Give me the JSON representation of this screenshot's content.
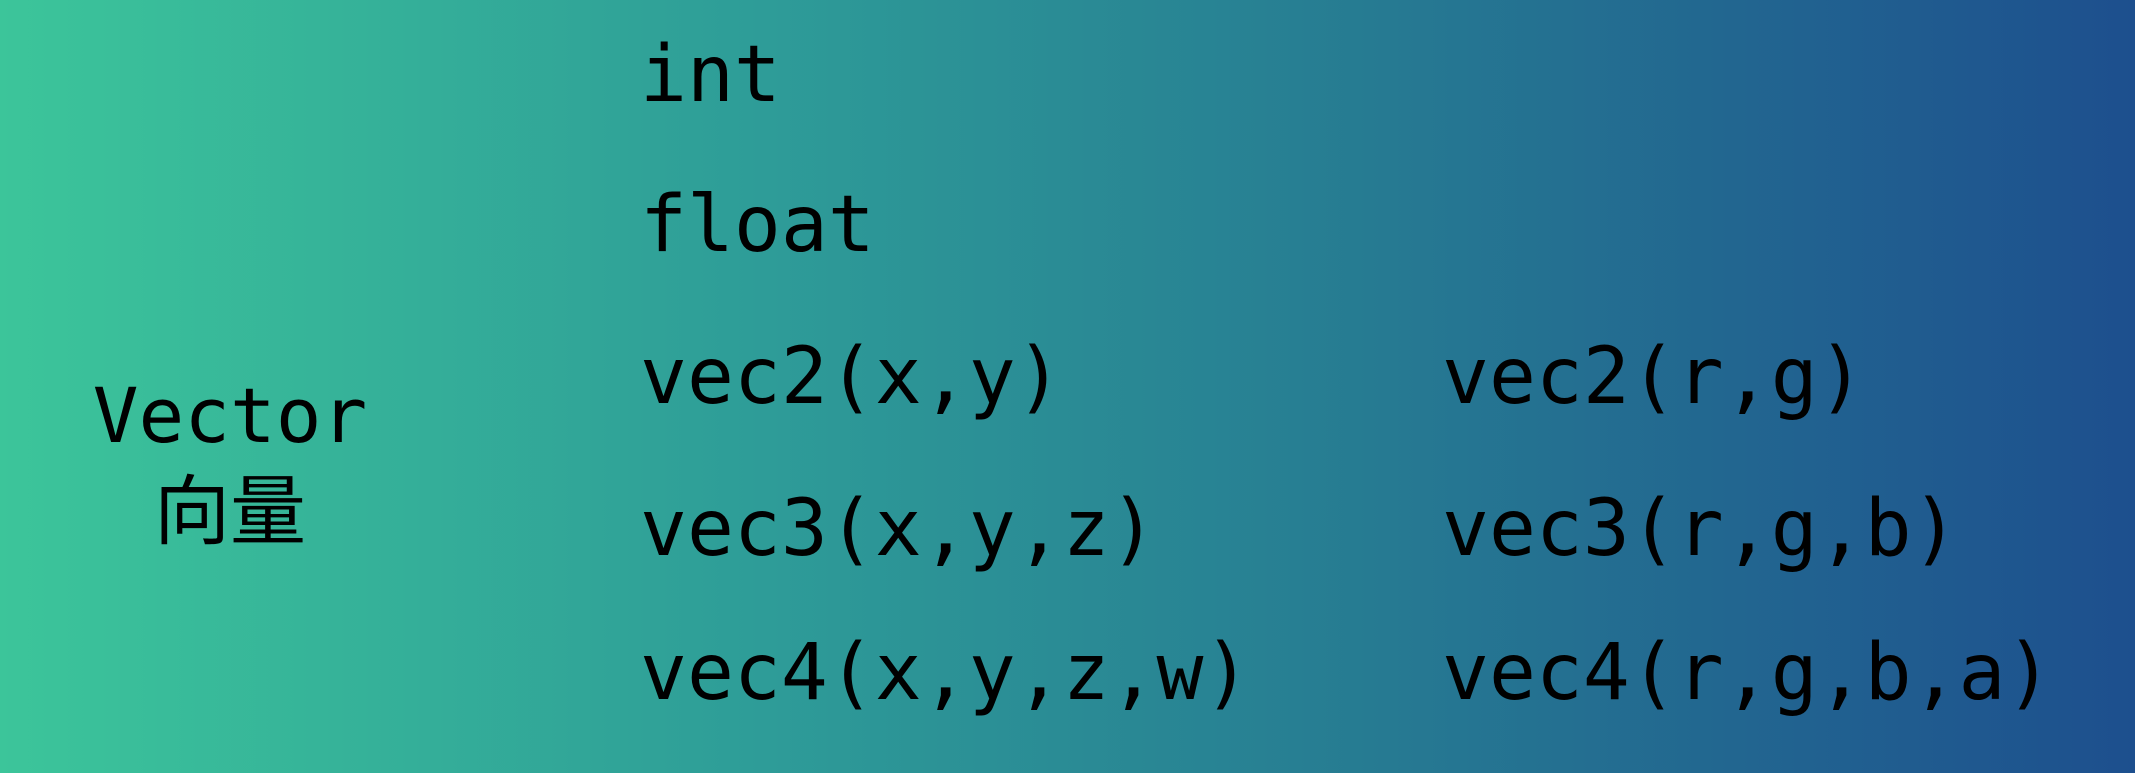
{
  "label": {
    "english": "Vector",
    "chinese": "向量"
  },
  "types": {
    "scalar_int": "int",
    "scalar_float": "float",
    "xyz": [
      "vec2(x,y)",
      "vec3(x,y,z)",
      "vec4(x,y,z,w)"
    ],
    "rgb": [
      "vec2(r,g)",
      "vec3(r,g,b)",
      "vec4(r,g,b,a)"
    ]
  },
  "colors": {
    "gradient_start": "#3cc59a",
    "gradient_end": "#1d4f8e",
    "text": "#000000"
  }
}
